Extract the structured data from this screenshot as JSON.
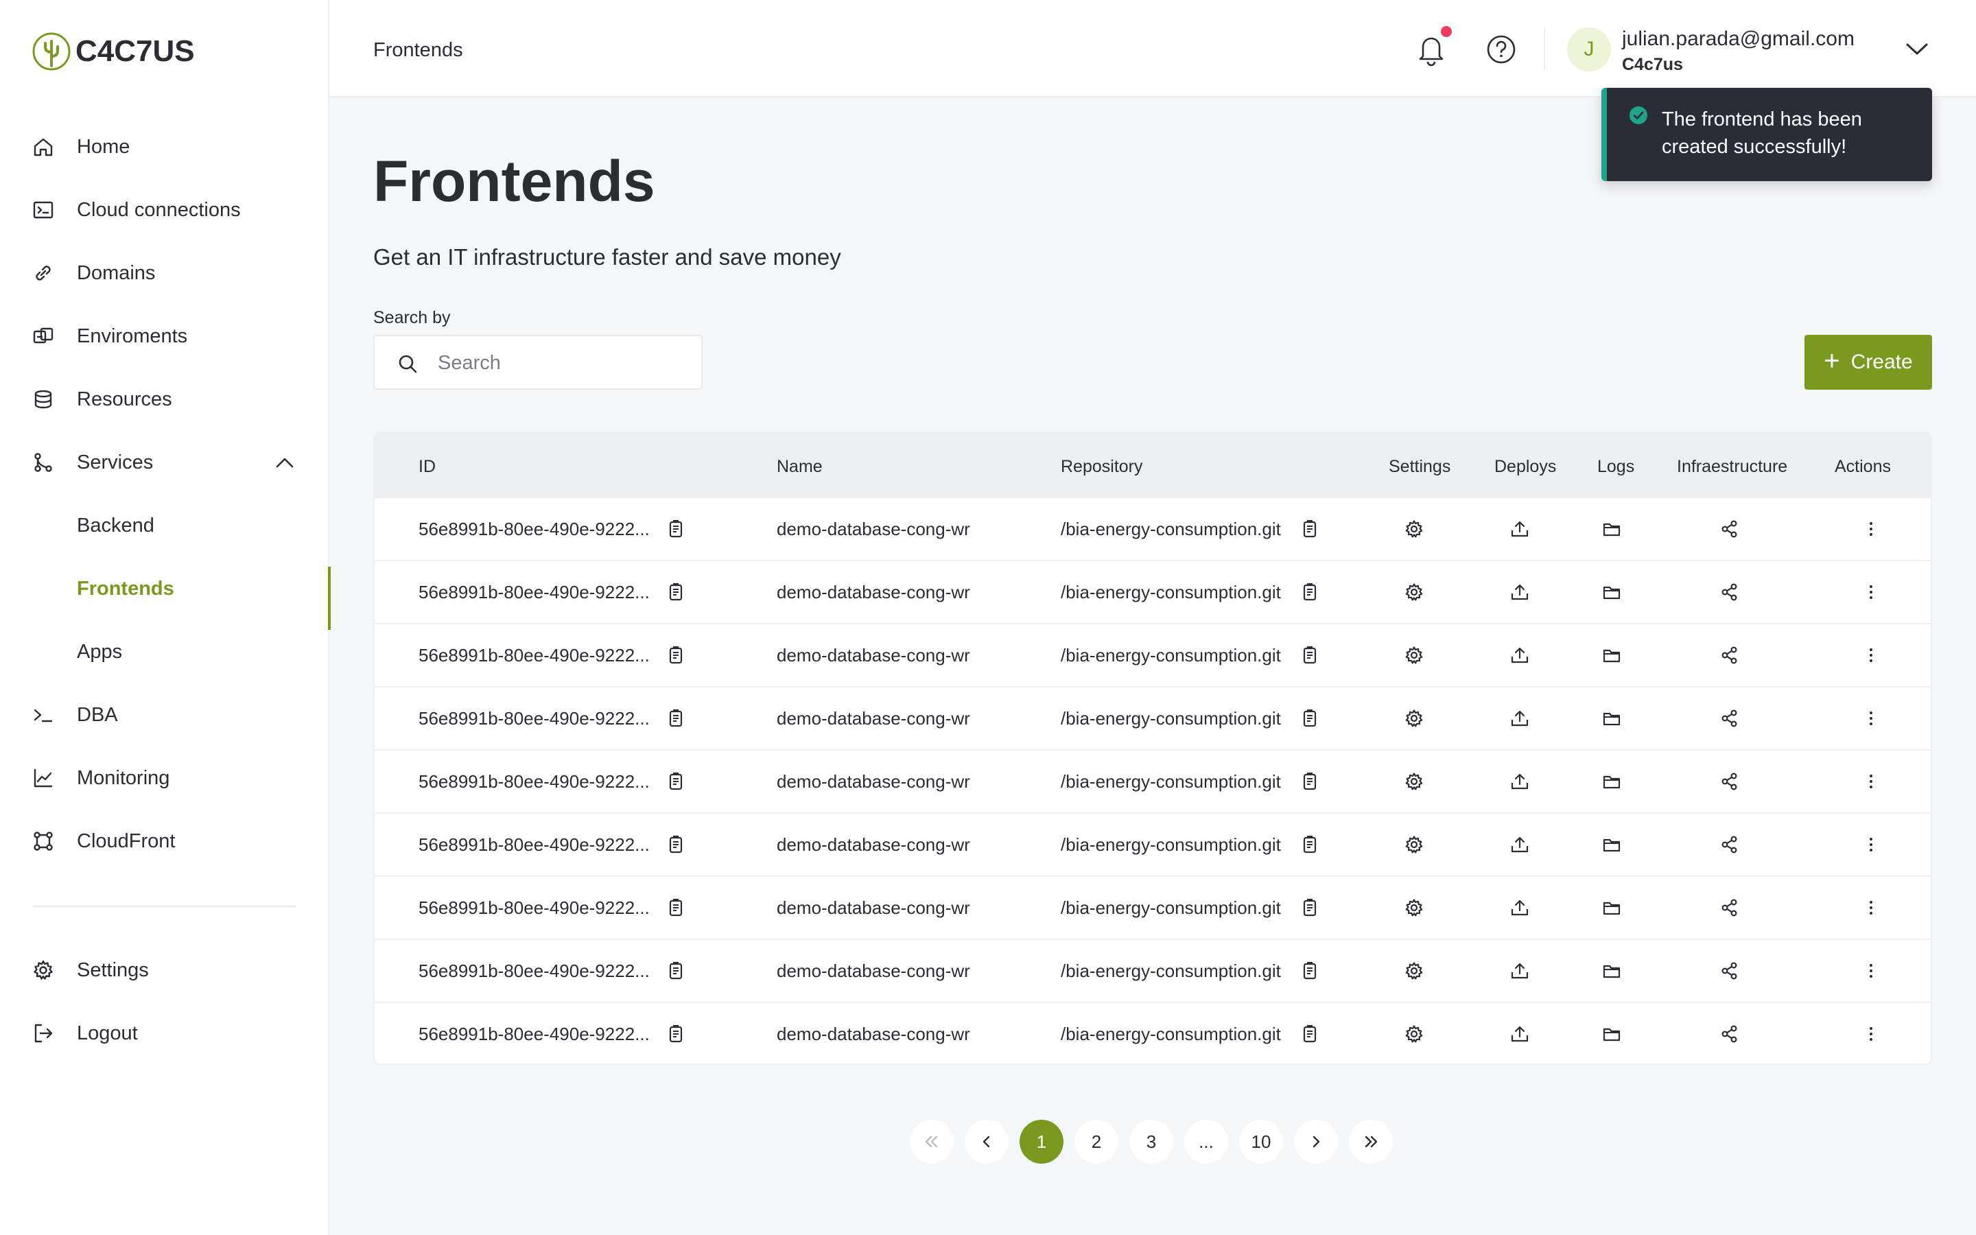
{
  "brand": {
    "name": "C4C7US",
    "accent": "#7a9a1f"
  },
  "sidebar": {
    "items": [
      {
        "label": "Home",
        "icon": "home-icon"
      },
      {
        "label": "Cloud connections",
        "icon": "terminal-box-icon"
      },
      {
        "label": "Domains",
        "icon": "link-icon"
      },
      {
        "label": "Enviroments",
        "icon": "environment-icon"
      },
      {
        "label": "Resources",
        "icon": "database-icon"
      },
      {
        "label": "Services",
        "icon": "services-icon",
        "expanded": true
      },
      {
        "label": "Backend",
        "sub": true
      },
      {
        "label": "Frontends",
        "sub": true,
        "active": true
      },
      {
        "label": "Apps",
        "sub": true
      },
      {
        "label": "DBA",
        "icon": "prompt-icon"
      },
      {
        "label": "Monitoring",
        "icon": "chart-line-icon"
      },
      {
        "label": "CloudFront",
        "icon": "cloudfront-icon"
      }
    ],
    "bottom": [
      {
        "label": "Settings",
        "icon": "gear-icon"
      },
      {
        "label": "Logout",
        "icon": "logout-icon"
      }
    ]
  },
  "header": {
    "title": "Frontends",
    "user": {
      "initial": "J",
      "email": "julian.parada@gmail.com",
      "org": "C4c7us"
    }
  },
  "toast": {
    "message": "The frontend has been created successfully!",
    "status_color": "#1fa38a"
  },
  "main": {
    "title": "Frontends",
    "subtitle": "Get an IT infrastructure faster and save money",
    "search": {
      "label": "Search by",
      "placeholder": "Search",
      "value": ""
    },
    "create_label": "Create"
  },
  "table": {
    "columns": [
      "ID",
      "Name",
      "Repository",
      "Settings",
      "Deploys",
      "Logs",
      "Infraestructure",
      "Actions"
    ],
    "rows": [
      {
        "id": "56e8991b-80ee-490e-9222...",
        "name": "demo-database-cong-wr",
        "repo": "/bia-energy-consumption.git"
      },
      {
        "id": "56e8991b-80ee-490e-9222...",
        "name": "demo-database-cong-wr",
        "repo": "/bia-energy-consumption.git"
      },
      {
        "id": "56e8991b-80ee-490e-9222...",
        "name": "demo-database-cong-wr",
        "repo": "/bia-energy-consumption.git"
      },
      {
        "id": "56e8991b-80ee-490e-9222...",
        "name": "demo-database-cong-wr",
        "repo": "/bia-energy-consumption.git"
      },
      {
        "id": "56e8991b-80ee-490e-9222...",
        "name": "demo-database-cong-wr",
        "repo": "/bia-energy-consumption.git"
      },
      {
        "id": "56e8991b-80ee-490e-9222...",
        "name": "demo-database-cong-wr",
        "repo": "/bia-energy-consumption.git"
      },
      {
        "id": "56e8991b-80ee-490e-9222...",
        "name": "demo-database-cong-wr",
        "repo": "/bia-energy-consumption.git"
      },
      {
        "id": "56e8991b-80ee-490e-9222...",
        "name": "demo-database-cong-wr",
        "repo": "/bia-energy-consumption.git"
      },
      {
        "id": "56e8991b-80ee-490e-9222...",
        "name": "demo-database-cong-wr",
        "repo": "/bia-energy-consumption.git"
      }
    ]
  },
  "pagination": {
    "pages": [
      "1",
      "2",
      "3",
      "...",
      "10"
    ],
    "current": "1"
  }
}
